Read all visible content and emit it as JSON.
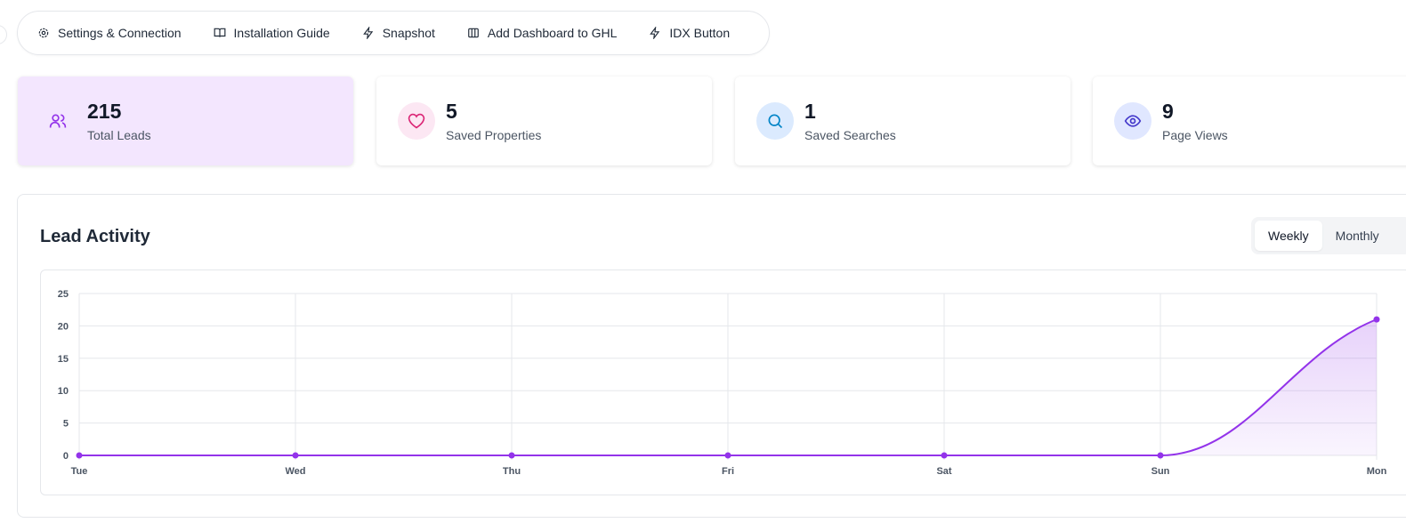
{
  "nav": [
    {
      "label": "Settings & Connection",
      "icon": "gear-icon"
    },
    {
      "label": "Installation Guide",
      "icon": "book-icon"
    },
    {
      "label": "Snapshot",
      "icon": "lightning-icon"
    },
    {
      "label": "Add Dashboard to GHL",
      "icon": "columns-icon"
    },
    {
      "label": "IDX Button",
      "icon": "lightning-icon"
    }
  ],
  "stats": [
    {
      "value": "215",
      "label": "Total Leads",
      "icon": "users-icon",
      "color": "#9333ea"
    },
    {
      "value": "5",
      "label": "Saved Properties",
      "icon": "heart-icon",
      "color": "#db2777"
    },
    {
      "value": "1",
      "label": "Saved Searches",
      "icon": "search-icon",
      "color": "#0284c7"
    },
    {
      "value": "9",
      "label": "Page Views",
      "icon": "eye-icon",
      "color": "#4338ca"
    }
  ],
  "activity": {
    "title": "Lead Activity",
    "toggle": [
      "Weekly",
      "Monthly"
    ],
    "selected": "Weekly"
  },
  "chart_data": {
    "type": "area",
    "categories": [
      "Tue",
      "Wed",
      "Thu",
      "Fri",
      "Sat",
      "Sun",
      "Mon"
    ],
    "values": [
      0,
      0,
      0,
      0,
      0,
      0,
      21
    ],
    "ylim": [
      0,
      25
    ],
    "yticks": [
      0,
      5,
      10,
      15,
      20,
      25
    ],
    "grid": true,
    "color": "#9333ea"
  }
}
